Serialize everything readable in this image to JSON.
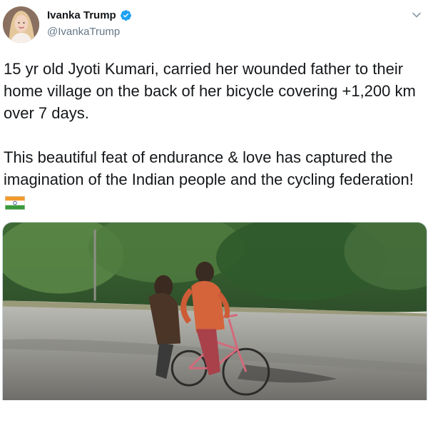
{
  "tweet": {
    "display_name": "Ivanka Trump",
    "handle": "@IvankaTrump",
    "paragraph_1": "15 yr old Jyoti Kumari, carried her wounded father to their home village on the back of her bicycle covering +1,200 km over 7 days.",
    "paragraph_2": "This beautiful feat of endurance & love has captured the imagination of the Indian people and the cycling federation!",
    "emoji": "india-flag",
    "icons": {
      "verified": "verified-badge-icon",
      "menu": "chevron-down-icon"
    },
    "colors": {
      "verified": "#1da1f2",
      "text": "#14171a",
      "muted": "#657786"
    }
  }
}
